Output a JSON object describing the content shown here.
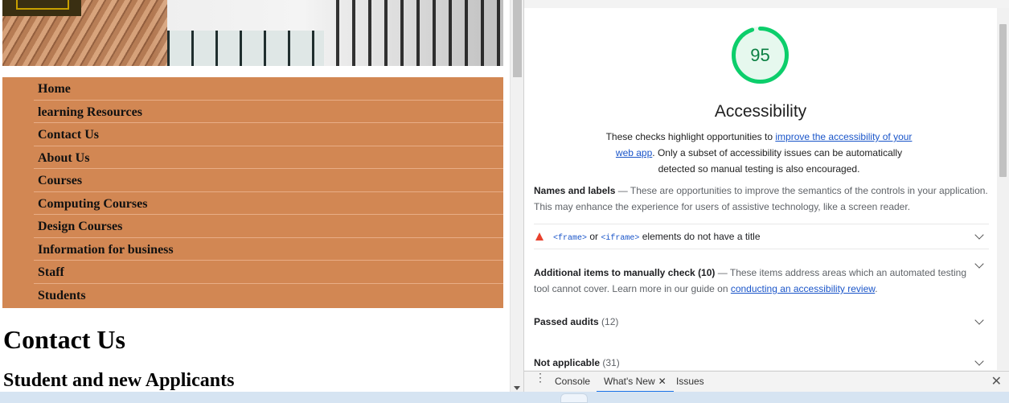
{
  "site": {
    "nav": [
      "Home",
      "learning Resources",
      "Contact Us",
      "About Us",
      "Courses",
      "Computing Courses",
      "Design Courses",
      "Information for business",
      "Staff",
      "Students"
    ],
    "heading": "Contact Us",
    "subheading": "Student and new Applicants"
  },
  "lighthouse": {
    "score": "95",
    "score_fraction": 0.95,
    "category_title": "Accessibility",
    "desc_pre": "These checks highlight opportunities to ",
    "desc_link": "improve the accessibility of your web app",
    "desc_post": ". Only a subset of accessibility issues can be automatically detected so manual testing is also encouraged.",
    "names_labels": {
      "title": "Names and labels",
      "desc": "These are opportunities to improve the semantics of the controls in your application. This may enhance the experience for users of assistive technology, like a screen reader."
    },
    "audit_frame": {
      "code1": "<frame>",
      "mid": "or",
      "code2": "<iframe>",
      "rest": "elements do not have a title"
    },
    "manual": {
      "title": "Additional items to manually check",
      "count": "(10)",
      "desc": "These items address areas which an automated testing tool cannot cover. Learn more in our guide on ",
      "link": "conducting an accessibility review",
      "end": "."
    },
    "passed": {
      "title": "Passed audits",
      "count": "(12)"
    },
    "not_applicable": {
      "title": "Not applicable",
      "count": "(31)"
    }
  },
  "drawer": {
    "tabs": [
      "Console",
      "What's New",
      "Issues"
    ],
    "active_tab": "What's New"
  },
  "colors": {
    "nav_bg": "#d28753",
    "score_green": "#0cce6b",
    "link_blue": "#1a55c9",
    "fail_red": "#e8412d"
  }
}
